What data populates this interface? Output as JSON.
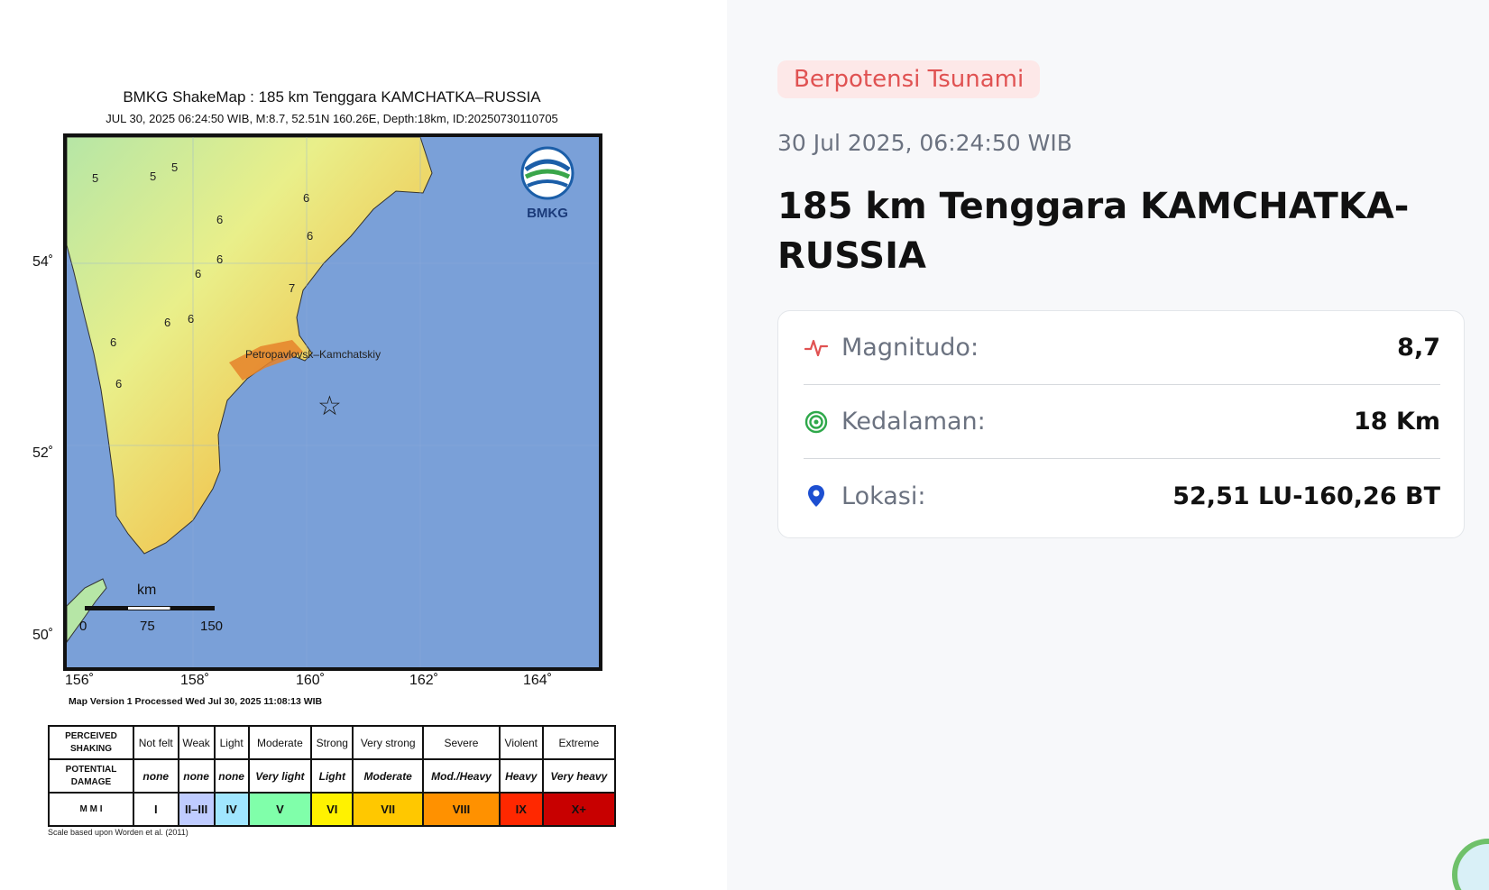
{
  "shakemap": {
    "title": "BMKG ShakeMap : 185 km Tenggara KAMCHATKA–RUSSIA",
    "subtitle": "JUL 30, 2025 06:24:50 WIB, M:8.7, 52.51N 160.26E, Depth:18km, ID:20250730110705",
    "logo_text": "BMKG",
    "city": "Petropavlovsk–Kamchatskiy",
    "lat_labels": [
      "54˚",
      "52˚",
      "50˚"
    ],
    "lon_labels": [
      "156˚",
      "158˚",
      "160˚",
      "162˚",
      "164˚"
    ],
    "scale_unit": "km",
    "scale_ticks": [
      "0",
      "75",
      "150"
    ],
    "contours": [
      "5",
      "5",
      "5",
      "6",
      "6",
      "6",
      "6",
      "6",
      "7",
      "6",
      "6",
      "6",
      "6"
    ],
    "map_version": "Map Version 1 Processed Wed Jul 30, 2025 11:08:13 WIB",
    "epicenter_icon": "star-icon",
    "legend": {
      "row1_head": "PERCEIVED SHAKING",
      "row2_head": "POTENTIAL DAMAGE",
      "row3_head": "M M I",
      "shaking": [
        "Not felt",
        "Weak",
        "Light",
        "Moderate",
        "Strong",
        "Very strong",
        "Severe",
        "Violent",
        "Extreme"
      ],
      "damage": [
        "none",
        "none",
        "none",
        "Very light",
        "Light",
        "Moderate",
        "Mod./Heavy",
        "Heavy",
        "Very heavy"
      ],
      "mmi": [
        "I",
        "II–III",
        "IV",
        "V",
        "VI",
        "VII",
        "VIII",
        "IX",
        "X+"
      ],
      "colors": [
        "#ffffff",
        "#bfccff",
        "#a0e6ff",
        "#80ffaa",
        "#fff200",
        "#ffc800",
        "#ff9100",
        "#ff2800",
        "#c80000"
      ]
    },
    "scale_note": "Scale based upon Worden et al. (2011)"
  },
  "info": {
    "badge": "Berpotensi Tsunami",
    "datetime": "30 Jul 2025, 06:24:50 WIB",
    "location_title": "185 km Tenggara KAMCHATKA-RUSSIA",
    "rows": [
      {
        "icon": "pulse-icon",
        "label": "Magnitudo:",
        "value": "8,7"
      },
      {
        "icon": "target-icon",
        "label": "Kedalaman:",
        "value": "18 Km"
      },
      {
        "icon": "map-pin-icon",
        "label": "Lokasi:",
        "value": "52,51 LU-160,26 BT"
      }
    ],
    "badge_color": "#e05252"
  }
}
